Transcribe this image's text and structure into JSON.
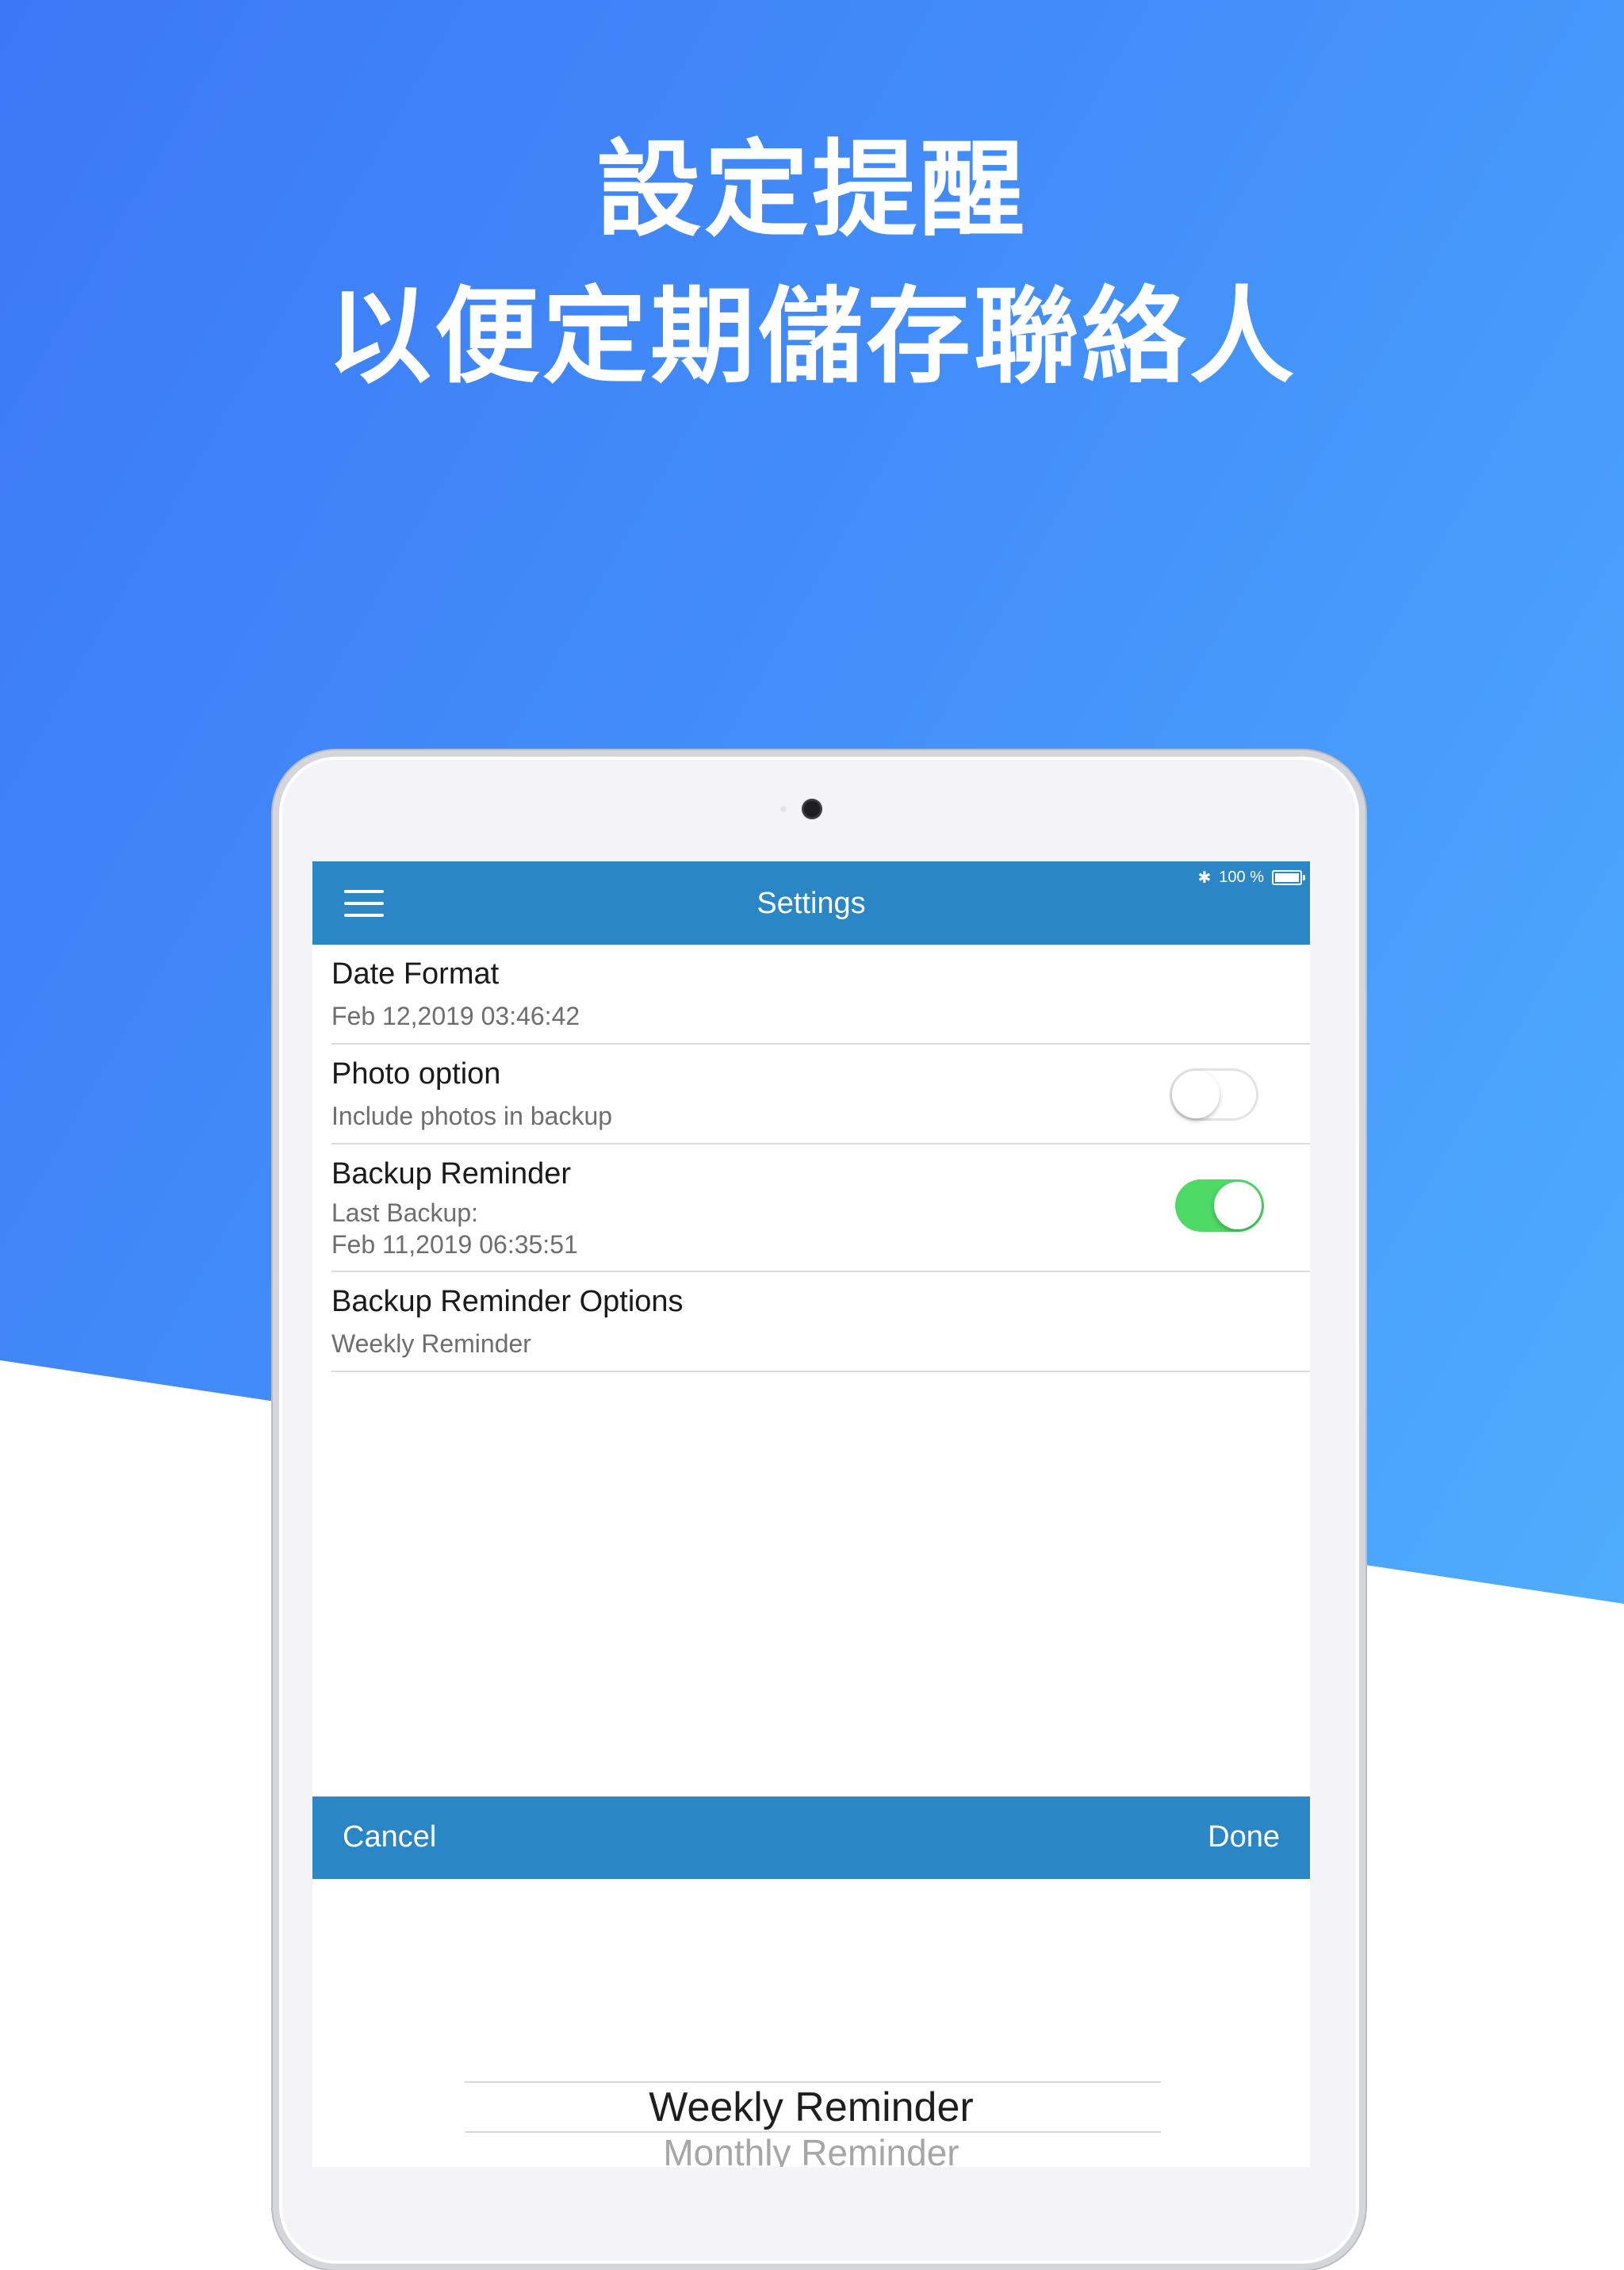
{
  "headline": {
    "line1": "設定提醒",
    "line2": "以便定期儲存聯絡人"
  },
  "status_bar": {
    "bluetooth_icon": "bluetooth-icon",
    "battery_text": "100 %",
    "battery_icon": "battery-icon"
  },
  "navbar": {
    "menu_icon": "hamburger-menu-icon",
    "title": "Settings"
  },
  "settings": {
    "date_format": {
      "title": "Date Format",
      "value": "Feb 12,2019 03:46:42"
    },
    "photo_option": {
      "title": "Photo option",
      "subtitle": "Include photos in backup",
      "toggle_on": false
    },
    "backup_reminder": {
      "title": "Backup Reminder",
      "last_backup_label": "Last Backup:",
      "last_backup_value": "Feb 11,2019 06:35:51",
      "toggle_on": true
    },
    "backup_reminder_options": {
      "title": "Backup Reminder Options",
      "value": "Weekly Reminder"
    }
  },
  "picker": {
    "cancel_label": "Cancel",
    "done_label": "Done",
    "options": [
      "Weekly Reminder",
      "Monthly Reminder"
    ],
    "selected": "Weekly Reminder"
  },
  "colors": {
    "bar_blue": "#2a86c5",
    "toggle_green": "#4cd964",
    "bg_gradient_start": "#3c78f6",
    "bg_gradient_end": "#52b4fd"
  }
}
